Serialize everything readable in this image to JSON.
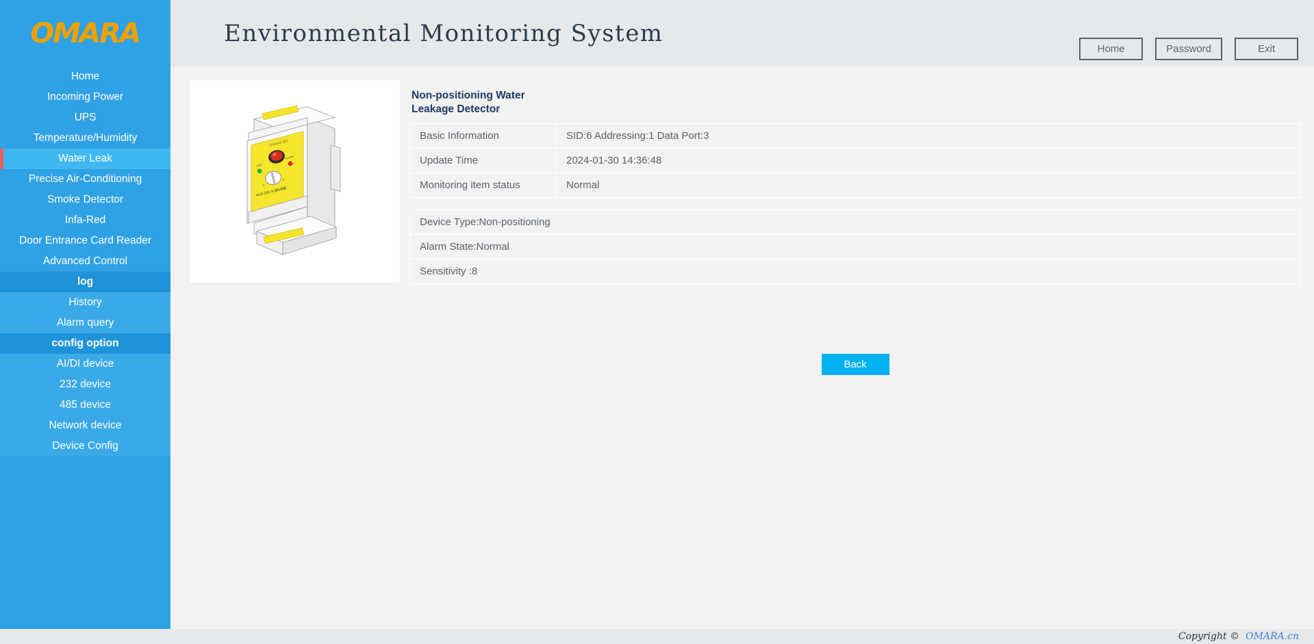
{
  "header": {
    "logo_text": "OMARA",
    "title": "Environmental Monitoring System",
    "buttons": [
      {
        "label": "Home",
        "name": "home-button"
      },
      {
        "label": "Password",
        "name": "password-button"
      },
      {
        "label": "Exit",
        "name": "exit-button"
      }
    ]
  },
  "sidebar": {
    "items": [
      {
        "label": "Home"
      },
      {
        "label": "Incoming Power"
      },
      {
        "label": "UPS"
      },
      {
        "label": "Temperature/Humidity"
      },
      {
        "label": "Water Leak",
        "active": true
      },
      {
        "label": "Precise Air-Conditioning"
      },
      {
        "label": "Smoke Detector"
      },
      {
        "label": "Infa-Red"
      },
      {
        "label": "Door Entrance Card Reader"
      },
      {
        "label": "Advanced Control"
      }
    ],
    "log_section": {
      "title": "log",
      "items": [
        {
          "label": "History"
        },
        {
          "label": "Alarm query"
        }
      ]
    },
    "config_section": {
      "title": "config option",
      "items": [
        {
          "label": "AI/DI device"
        },
        {
          "label": "232 device"
        },
        {
          "label": "485 device"
        },
        {
          "label": "Network device"
        },
        {
          "label": "Device Config"
        }
      ]
    }
  },
  "main": {
    "device_title": "Non-positioning Water Leakage Detector",
    "device_image_name": "water-leak-detector-image",
    "info_rows": [
      {
        "label": "Basic Information",
        "value": "SID:6   Addressing:1   Data Port:3"
      },
      {
        "label": "Update Time",
        "value": "2024-01-30 14:36:48"
      },
      {
        "label": "Monitoring item status",
        "value": "Normal"
      }
    ],
    "property_rows": [
      {
        "text": "Device Type:Non-positioning"
      },
      {
        "text": "Alarm State:Normal"
      },
      {
        "text": "Sensitivity :8"
      }
    ],
    "back_label": "Back"
  },
  "footer": {
    "copyright": "Copyright ©",
    "link": "OMARA.cn"
  },
  "colors": {
    "sidebar_blue": "#2fa1e5",
    "sidebar_active": "#3fb8f2",
    "sidebar_section": "#1f93da",
    "active_marker_red": "#e8615d",
    "logo_orange": "#eda101",
    "title_navy": "#1f3864",
    "back_button_cyan": "#00b0f0",
    "header_gray": "#e6e9eb",
    "body_gray": "#f2f2f2",
    "link_blue": "#3d7fd6"
  }
}
